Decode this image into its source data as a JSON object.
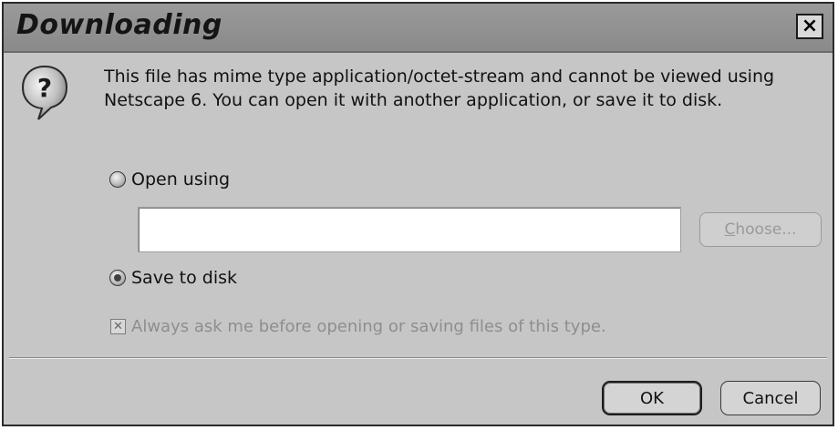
{
  "window": {
    "title": "Downloading",
    "close_glyph": "×"
  },
  "message": {
    "icon": "question-balloon-icon",
    "text": "This file has mime type application/octet-stream and cannot be viewed using Netscape 6. You can open it with another application, or save it to disk."
  },
  "open_option": {
    "label": "Open using",
    "selected": false
  },
  "app_field": {
    "value": "",
    "placeholder": ""
  },
  "choose_button": {
    "mnemonic": "C",
    "rest": "hoose...",
    "enabled": false
  },
  "save_option": {
    "label": "Save to disk",
    "selected": true
  },
  "always_ask": {
    "label": "Always ask me before opening or saving files of this type.",
    "checked": true,
    "enabled": false,
    "check_glyph": "✕"
  },
  "buttons": {
    "ok": "OK",
    "cancel": "Cancel"
  },
  "colors": {
    "dialog_bg": "#c6c6c6",
    "titlebar_bg": "#8f8f8f",
    "disabled_text": "#8e8e8e"
  }
}
